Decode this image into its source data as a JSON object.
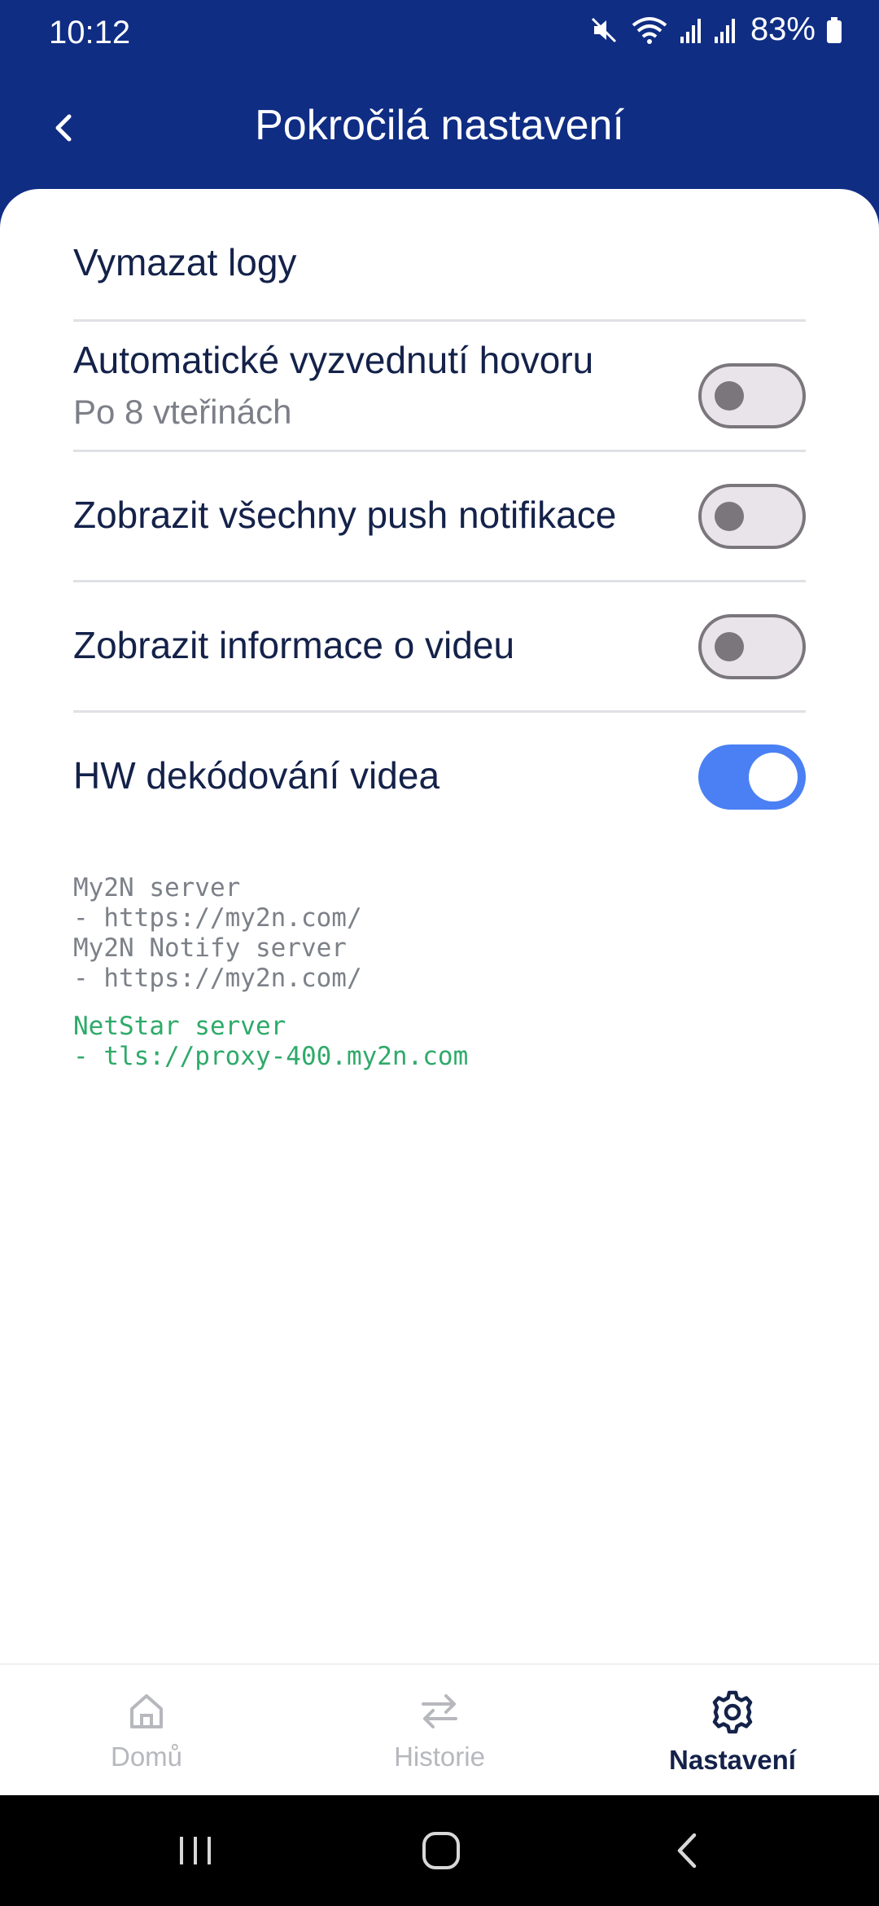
{
  "status_bar": {
    "time": "10:12",
    "battery": "83%",
    "icons": [
      "mute-icon",
      "wifi-icon",
      "signal-icon",
      "signal-icon",
      "battery-icon"
    ]
  },
  "header": {
    "title": "Pokročilá nastavení",
    "back_icon": "chevron-left-icon"
  },
  "settings": {
    "clear_logs": {
      "title": "Vymazat logy"
    },
    "auto_answer": {
      "title": "Automatické vyzvednutí hovoru",
      "subtitle": "Po 8 vteřinách",
      "enabled": false
    },
    "push_notifications": {
      "title": "Zobrazit všechny push notifikace",
      "enabled": false
    },
    "video_info": {
      "title": "Zobrazit informace o videu",
      "enabled": false
    },
    "hw_decoding": {
      "title": "HW dekódování videa",
      "enabled": true
    }
  },
  "server_info": {
    "my2n_server": "My2N server",
    "my2n_server_url": "- https://my2n.com/",
    "my2n_notify_server": "My2N Notify server",
    "my2n_notify_server_url": "- https://my2n.com/",
    "netstar_server": "NetStar server",
    "netstar_server_url": "- tls://proxy-400.my2n.com"
  },
  "bottom_nav": {
    "items": [
      {
        "label": "Domů",
        "icon": "home-icon",
        "active": false
      },
      {
        "label": "Historie",
        "icon": "swap-arrows-icon",
        "active": false
      },
      {
        "label": "Nastavení",
        "icon": "gear-icon",
        "active": true
      }
    ]
  },
  "system_nav": {
    "icons": [
      "recents-icon",
      "home-circle-icon",
      "back-icon"
    ]
  },
  "colors": {
    "header_bg": "#102d84",
    "toggle_on": "#4a80f4",
    "text_primary": "#14224a",
    "server_green": "#2faa6a"
  }
}
